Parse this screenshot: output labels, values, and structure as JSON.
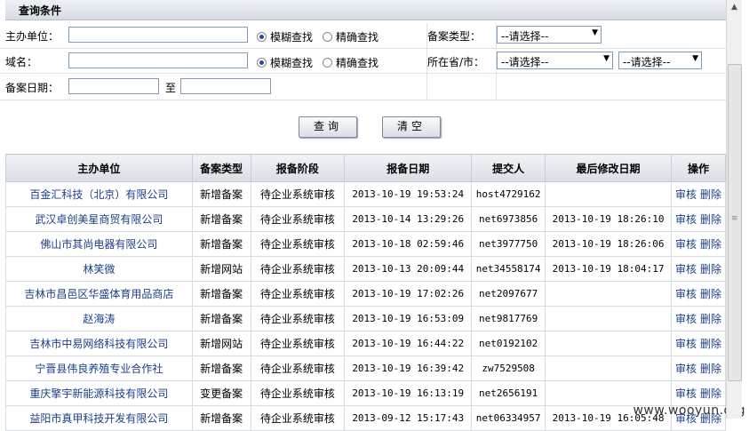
{
  "panel": {
    "title": "查询条件"
  },
  "form": {
    "unit_label": "主办单位：",
    "domain_label": "域名：",
    "date_label": "备案日期：",
    "date_to": "至",
    "fuzzy": "模糊查找",
    "exact": "精确查找",
    "type_label": "备案类型：",
    "region_label": "所在省/市：",
    "type_value": "--请选择--",
    "prov_value": "--请选择--",
    "city_value": "--请选择--"
  },
  "buttons": {
    "query": "查询",
    "clear": "清空"
  },
  "table": {
    "headers": [
      "主办单位",
      "备案类型",
      "报备阶段",
      "报备日期",
      "提交人",
      "最后修改日期",
      "操作"
    ],
    "actions": {
      "review": "审核",
      "delete": "删除"
    },
    "rows": [
      {
        "unit": "百金汇科技（北京）有限公司",
        "type": "新增备案",
        "stage": "待企业系统审核",
        "date": "2013-10-19 19:53:24",
        "submitter": "host4729162",
        "modified": ""
      },
      {
        "unit": "武汉卓创美星商贸有限公司",
        "type": "新增备案",
        "stage": "待企业系统审核",
        "date": "2013-10-14 13:29:26",
        "submitter": "net6973856",
        "modified": "2013-10-19 18:26:10"
      },
      {
        "unit": "佛山市其尚电器有限公司",
        "type": "新增备案",
        "stage": "待企业系统审核",
        "date": "2013-10-18 02:59:46",
        "submitter": "net3977750",
        "modified": "2013-10-19 18:26:06"
      },
      {
        "unit": "林笑微",
        "type": "新增网站",
        "stage": "待企业系统审核",
        "date": "2013-10-13 20:09:44",
        "submitter": "net34558174",
        "modified": "2013-10-19 18:04:17"
      },
      {
        "unit": "吉林市昌邑区华盛体育用品商店",
        "type": "新增备案",
        "stage": "待企业系统审核",
        "date": "2013-10-19 17:02:26",
        "submitter": "net2097677",
        "modified": ""
      },
      {
        "unit": "赵海涛",
        "type": "新增备案",
        "stage": "待企业系统审核",
        "date": "2013-10-19 16:53:09",
        "submitter": "net9817769",
        "modified": ""
      },
      {
        "unit": "吉林市中易网络科技有限公司",
        "type": "新增网站",
        "stage": "待企业系统审核",
        "date": "2013-10-19 16:44:22",
        "submitter": "net0192102",
        "modified": ""
      },
      {
        "unit": "宁晋县伟良养殖专业合作社",
        "type": "新增备案",
        "stage": "待企业系统审核",
        "date": "2013-10-19 16:39:42",
        "submitter": "zw7529508",
        "modified": ""
      },
      {
        "unit": "重庆擎宇新能源科技有限公司",
        "type": "变更备案",
        "stage": "待企业系统审核",
        "date": "2013-10-19 16:13:19",
        "submitter": "net2656191",
        "modified": ""
      },
      {
        "unit": "益阳市真甲科技开发有限公司",
        "type": "新增备案",
        "stage": "待企业系统审核",
        "date": "2013-09-12 15:17:43",
        "submitter": "net06334957",
        "modified": "2013-10-19 16:05:48"
      }
    ]
  },
  "watermark": "www.wooyun.org"
}
